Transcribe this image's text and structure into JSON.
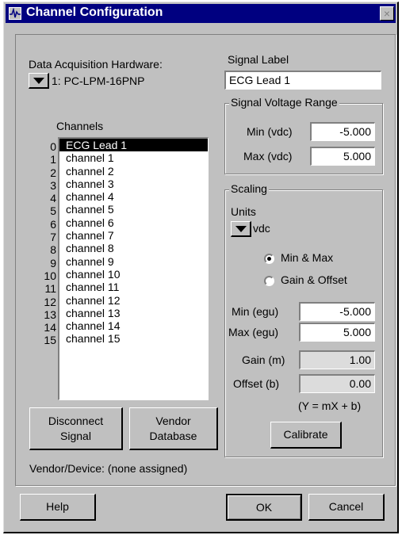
{
  "window": {
    "title": "Channel Configuration",
    "icon": "waveform-icon",
    "close": "×"
  },
  "hardware": {
    "label": "Data Acquisition Hardware:",
    "value": "1: PC-LPM-16PNP"
  },
  "signal_label": {
    "label": "Signal Label",
    "value": "ECG Lead 1"
  },
  "voltage_range": {
    "title": "Signal Voltage Range",
    "min_label": "Min (vdc)",
    "min_value": "-5.000",
    "max_label": "Max (vdc)",
    "max_value": "5.000"
  },
  "channels": {
    "label": "Channels",
    "items": [
      {
        "num": "0",
        "name": "ECG Lead 1"
      },
      {
        "num": "1",
        "name": "channel 1"
      },
      {
        "num": "2",
        "name": "channel 2"
      },
      {
        "num": "3",
        "name": "channel 3"
      },
      {
        "num": "4",
        "name": "channel 4"
      },
      {
        "num": "5",
        "name": "channel 5"
      },
      {
        "num": "6",
        "name": "channel 6"
      },
      {
        "num": "7",
        "name": "channel 7"
      },
      {
        "num": "8",
        "name": "channel 8"
      },
      {
        "num": "9",
        "name": "channel 9"
      },
      {
        "num": "10",
        "name": "channel 10"
      },
      {
        "num": "11",
        "name": "channel 11"
      },
      {
        "num": "12",
        "name": "channel 12"
      },
      {
        "num": "13",
        "name": "channel 13"
      },
      {
        "num": "14",
        "name": "channel 14"
      },
      {
        "num": "15",
        "name": "channel 15"
      }
    ]
  },
  "scaling": {
    "title": "Scaling",
    "units_label": "Units",
    "units_value": "vdc",
    "radio_minmax": "Min & Max",
    "radio_gain": "Gain & Offset",
    "selected_mode": "Min & Max",
    "min_egu_label": "Min (egu)",
    "min_egu_value": "-5.000",
    "max_egu_label": "Max (egu)",
    "max_egu_value": "5.000",
    "gain_label": "Gain (m)",
    "gain_value": "1.00",
    "offset_label": "Offset (b)",
    "offset_value": "0.00",
    "formula": "(Y = mX + b)",
    "calibrate": "Calibrate"
  },
  "buttons": {
    "disconnect_line1": "Disconnect",
    "disconnect_line2": "Signal",
    "vendor_line1": "Vendor",
    "vendor_line2": "Database",
    "help": "Help",
    "ok": "OK",
    "cancel": "Cancel"
  },
  "vendor_device": "Vendor/Device:  (none assigned)"
}
